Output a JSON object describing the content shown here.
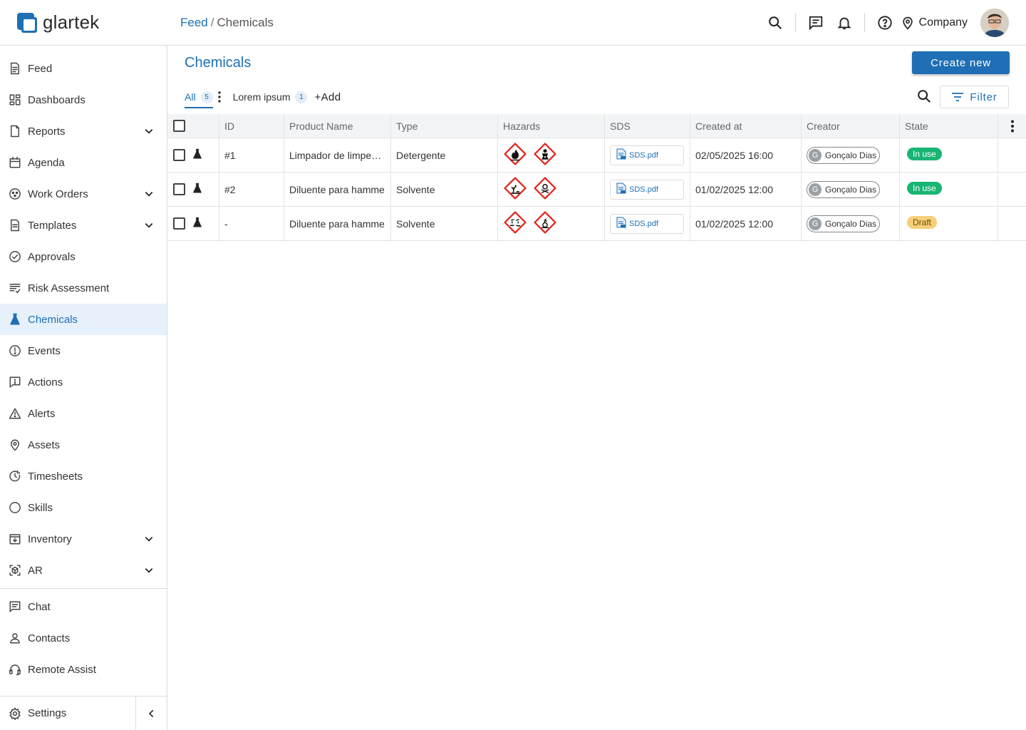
{
  "brand": {
    "name": "glartek"
  },
  "breadcrumb": {
    "parent": "Feed",
    "separator": "/",
    "current": "Chemicals"
  },
  "header": {
    "company_label": "Company"
  },
  "sidebar": {
    "items": [
      {
        "label": "Feed",
        "icon": "feed-icon"
      },
      {
        "label": "Dashboards",
        "icon": "dashboard-icon"
      },
      {
        "label": "Reports",
        "icon": "report-icon",
        "expandable": true
      },
      {
        "label": "Agenda",
        "icon": "calendar-icon"
      },
      {
        "label": "Work Orders",
        "icon": "work-orders-icon",
        "expandable": true
      },
      {
        "label": "Templates",
        "icon": "template-icon",
        "expandable": true
      },
      {
        "label": "Approvals",
        "icon": "check-circle-icon"
      },
      {
        "label": "Risk Assessment",
        "icon": "checklist-icon"
      },
      {
        "label": "Chemicals",
        "icon": "flask-icon",
        "active": true
      },
      {
        "label": "Events",
        "icon": "exclamation-circle-icon"
      },
      {
        "label": "Actions",
        "icon": "action-icon"
      },
      {
        "label": "Alerts",
        "icon": "warning-triangle-icon"
      },
      {
        "label": "Assets",
        "icon": "location-pin-icon"
      },
      {
        "label": "Timesheets",
        "icon": "timer-icon"
      },
      {
        "label": "Skills",
        "icon": "circle-icon"
      },
      {
        "label": "Inventory",
        "icon": "inventory-icon",
        "expandable": true
      },
      {
        "label": "AR",
        "icon": "ar-icon",
        "expandable": true
      }
    ],
    "secondary": [
      {
        "label": "Chat",
        "icon": "chat-icon"
      },
      {
        "label": "Contacts",
        "icon": "person-icon"
      },
      {
        "label": "Remote Assist",
        "icon": "headset-icon"
      }
    ],
    "settings_label": "Settings"
  },
  "main": {
    "title": "Chemicals",
    "create_label": "Create new",
    "tabs": [
      {
        "label": "All",
        "count": "5",
        "active": true
      },
      {
        "label": "Lorem ipsum",
        "count": "1"
      }
    ],
    "add_view_label": "+Add",
    "filter_label": "Filter"
  },
  "table": {
    "columns": [
      "ID",
      "Product Name",
      "Type",
      "Hazards",
      "SDS",
      "Created at",
      "Creator",
      "State"
    ],
    "rows": [
      {
        "id": "#1",
        "name": "Limpador de limpe…",
        "type": "Detergente",
        "hazards": [
          "flammable-icon",
          "health-hazard-icon"
        ],
        "sds": "SDS.pdf",
        "created": "02/05/2025 16:00",
        "creator_initial": "G",
        "creator": "Gonçalo Dias",
        "state": "In use",
        "state_kind": "inuse"
      },
      {
        "id": "#2",
        "name": "Diluente para hamme",
        "type": "Solvente",
        "hazards": [
          "environment-hazard-icon",
          "toxic-icon"
        ],
        "sds": "SDS.pdf",
        "created": "01/02/2025 12:00",
        "creator_initial": "G",
        "creator": "Gonçalo Dias",
        "state": "In use",
        "state_kind": "inuse"
      },
      {
        "id": "-",
        "name": "Diluente para hamme",
        "type": "Solvente",
        "hazards": [
          "corrosive-icon",
          "oxidizing-icon"
        ],
        "sds": "SDS.pdf",
        "created": "01/02/2025 12:00",
        "creator_initial": "G",
        "creator": "Gonçalo Dias",
        "state": "Draft",
        "state_kind": "draft"
      }
    ]
  },
  "colors": {
    "accent": "#1e6fb5",
    "in_use": "#19b572",
    "draft": "#f7cf78",
    "hazard_border": "#e1251b"
  }
}
